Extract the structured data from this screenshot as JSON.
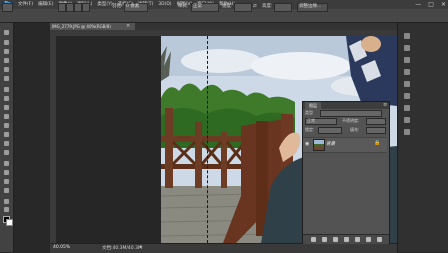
{
  "app": {
    "logo_text": "Ps"
  },
  "menu": {
    "items": [
      "文件(F)",
      "编辑(E)",
      "图像(I)",
      "图层(L)",
      "类型(Y)",
      "选择(S)",
      "滤镜(T)",
      "3D(D)",
      "视图(V)",
      "窗口(W)",
      "帮助(H)"
    ]
  },
  "window_controls": {
    "minimize": "—",
    "maximize": "□",
    "close": "✕"
  },
  "options": {
    "feather_label": "羽化:",
    "feather_value": "0 像素",
    "style_label": "样式:",
    "style_value": "正常",
    "width_label": "宽度:",
    "height_label": "高度:",
    "refine_edge": "调整边缘..."
  },
  "document": {
    "title": "IMG_2779.JPG @ 40%(RGB/8)",
    "close": "×"
  },
  "status": {
    "zoom": "40.05%",
    "doc_size": "文档:40.3M/40.3M",
    "arrow": "▸"
  },
  "layers": {
    "tab": "图层",
    "kind_label": "类型",
    "blend_mode": "正常",
    "opacity_label": "不透明度:",
    "lock_label": "锁定:",
    "fill_label": "填充:",
    "layer_name": "背景",
    "menu_icon": "≡"
  }
}
